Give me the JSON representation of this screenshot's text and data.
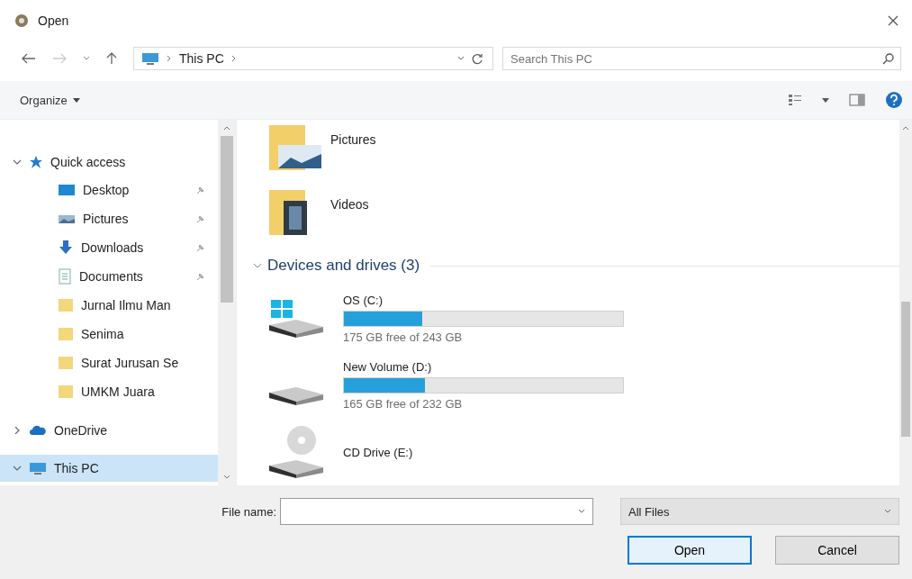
{
  "window": {
    "title": "Open"
  },
  "address": {
    "path": "This PC"
  },
  "search": {
    "placeholder": "Search This PC"
  },
  "toolbar": {
    "organize": "Organize"
  },
  "sidebar": {
    "items": [
      {
        "label": "Quick access",
        "kind": "star",
        "expanded": true,
        "selected": false,
        "children": [
          {
            "label": "Desktop",
            "kind": "desktop",
            "pinned": true,
            "selected": false
          },
          {
            "label": "Pictures",
            "kind": "pictures",
            "pinned": true,
            "selected": false
          },
          {
            "label": "Downloads",
            "kind": "downloads",
            "pinned": true,
            "selected": false
          },
          {
            "label": "Documents",
            "kind": "documents",
            "pinned": true,
            "selected": false
          },
          {
            "label": "Jurnal Ilmu Man",
            "kind": "folder",
            "pinned": false,
            "selected": false
          },
          {
            "label": "Senima",
            "kind": "folder",
            "pinned": false,
            "selected": false
          },
          {
            "label": "Surat Jurusan Se",
            "kind": "folder",
            "pinned": false,
            "selected": false
          },
          {
            "label": "UMKM Juara",
            "kind": "folder",
            "pinned": false,
            "selected": false
          }
        ]
      },
      {
        "label": "OneDrive",
        "kind": "cloud",
        "expanded": false,
        "selected": false
      },
      {
        "label": "This PC",
        "kind": "pc",
        "expanded": true,
        "selected": true
      }
    ]
  },
  "folders": [
    {
      "name": "Pictures",
      "kind": "pictures"
    },
    {
      "name": "Videos",
      "kind": "videos"
    }
  ],
  "group": {
    "title": "Devices and drives (3)"
  },
  "drives": [
    {
      "name": "OS (C:)",
      "kind": "system",
      "level": 0.28,
      "free": "175 GB free of 243 GB"
    },
    {
      "name": "New Volume (D:)",
      "kind": "disk",
      "level": 0.29,
      "free": "165 GB free of 232 GB"
    },
    {
      "name": "CD Drive (E:)",
      "kind": "cd"
    }
  ],
  "footer": {
    "file_name_label": "File name:",
    "file_type": "All Files",
    "open": "Open",
    "cancel": "Cancel"
  }
}
